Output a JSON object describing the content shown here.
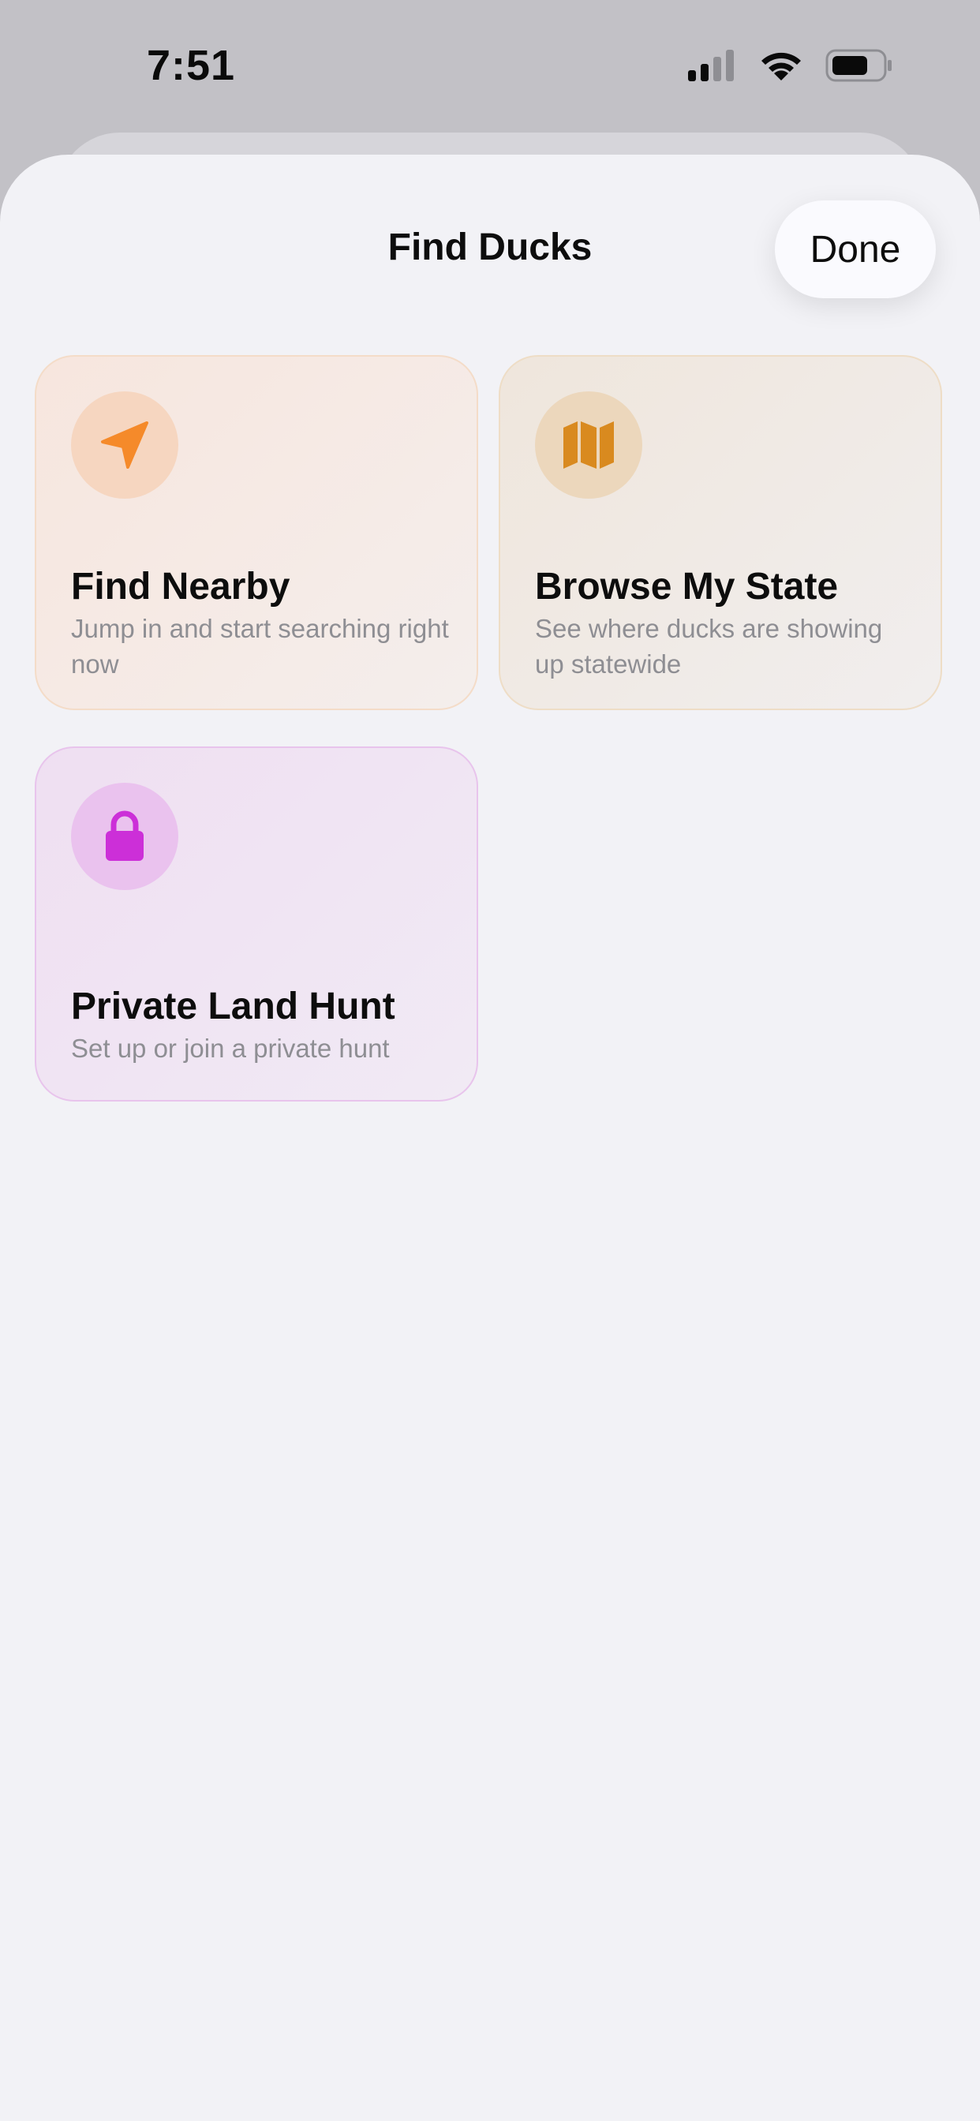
{
  "status_bar": {
    "time": "7:51",
    "icons": [
      "cellular-signal-icon",
      "wifi-icon",
      "battery-icon"
    ]
  },
  "sheet": {
    "title": "Find Ducks",
    "done_label": "Done"
  },
  "cards": [
    {
      "title": "Find Nearby",
      "subtitle": "Jump in and start searching right now",
      "icon": "location-arrow-icon",
      "accent": "#f58a2a"
    },
    {
      "title": "Browse My State",
      "subtitle": "See where ducks are showing up statewide",
      "icon": "map-icon",
      "accent": "#d98a1f"
    },
    {
      "title": "Private Land Hunt",
      "subtitle": "Set up or join a private hunt",
      "icon": "lock-icon",
      "accent": "#cc2fd8"
    }
  ],
  "colors": {
    "background": "#f2f2f6",
    "overlay": "#c2c1c6",
    "orange_accent": "#f58a2a",
    "gold_accent": "#d98a1f",
    "purple_accent": "#cc2fd8"
  }
}
